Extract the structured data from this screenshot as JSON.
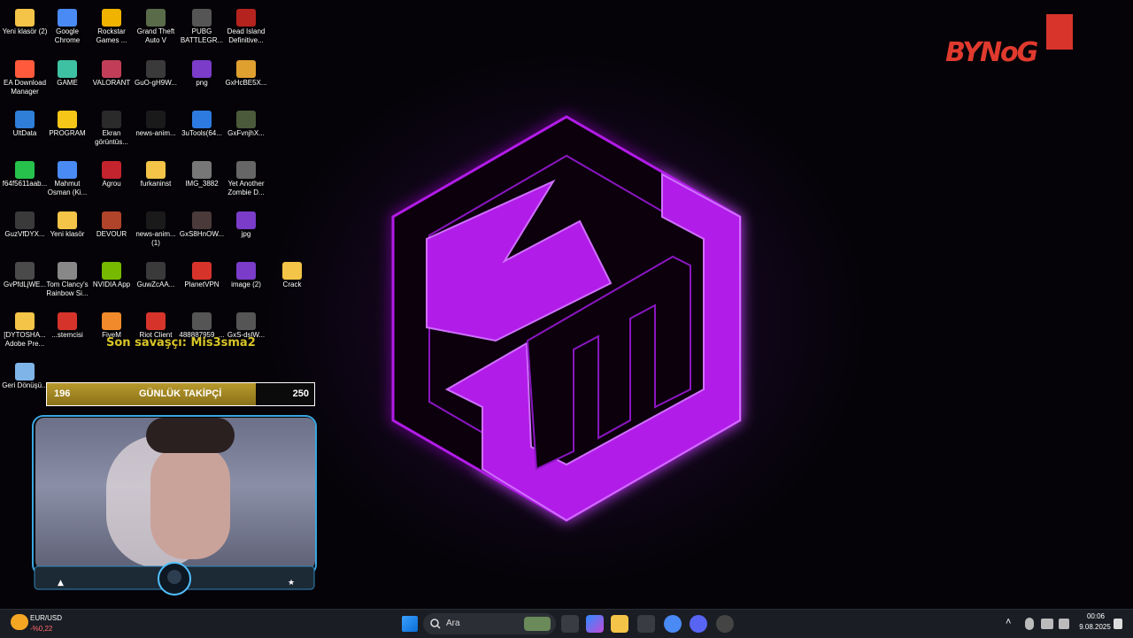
{
  "desktop": {
    "icons": [
      {
        "label": "Yeni klasör (2)",
        "color": "#f3c447"
      },
      {
        "label": "Google Chrome",
        "color": "#4a8af4"
      },
      {
        "label": "Rockstar Games ...",
        "color": "#f0b400"
      },
      {
        "label": "Grand Theft Auto V",
        "color": "#5a6b4a"
      },
      {
        "label": "PUBG BATTLEGR...",
        "color": "#555"
      },
      {
        "label": "Dead Island Definitive...",
        "color": "#b5231e"
      },
      {
        "label": "EA Download Manager",
        "color": "#ff5a3c"
      },
      {
        "label": "GAME",
        "color": "#3ec1a2"
      },
      {
        "label": "VALORANT",
        "color": "#c23e58"
      },
      {
        "label": "GuO-gH9W...",
        "color": "#3a3a3a"
      },
      {
        "label": "png",
        "color": "#7a3cc9"
      },
      {
        "label": "GxHcBE5X...",
        "color": "#e0a030"
      },
      {
        "label": "UltData",
        "color": "#2f7ed8"
      },
      {
        "label": "PROGRAM",
        "color": "#f5c518"
      },
      {
        "label": "Ekran görüntüs...",
        "color": "#2a2a2a"
      },
      {
        "label": "news-anim...",
        "color": "#1a1a1a"
      },
      {
        "label": "3uTools(64...",
        "color": "#2d7be0"
      },
      {
        "label": "GxFvnjhX...",
        "color": "#4a5a3a"
      },
      {
        "label": "f64f5611aab...",
        "color": "#27c24c"
      },
      {
        "label": "Mahmut Osman (Ki...",
        "color": "#4a8af4"
      },
      {
        "label": "Agrou",
        "color": "#c4242d"
      },
      {
        "label": "furkaninst",
        "color": "#f3c447"
      },
      {
        "label": "IMG_3882",
        "color": "#777"
      },
      {
        "label": "Yet Another Zombie D...",
        "color": "#666"
      },
      {
        "label": "GuzVfDYX...",
        "color": "#3a3a3a"
      },
      {
        "label": "Yeni klasör",
        "color": "#f3c447"
      },
      {
        "label": "DEVOUR",
        "color": "#b0442a"
      },
      {
        "label": "news-anim... (1)",
        "color": "#1a1a1a"
      },
      {
        "label": "GxS8HnOW...",
        "color": "#4a3a3a"
      },
      {
        "label": "jpg",
        "color": "#7a3cc9"
      },
      {
        "label": "GvPfdLjWE...",
        "color": "#4a4a4a"
      },
      {
        "label": "Tom Clancy's Rainbow Si...",
        "color": "#888"
      },
      {
        "label": "NVIDIA App",
        "color": "#76b900"
      },
      {
        "label": "GuwZcAA...",
        "color": "#3a3a3a"
      },
      {
        "label": "PlanetVPN",
        "color": "#d6342b"
      },
      {
        "label": "image (2)",
        "color": "#7a3cc9"
      },
      {
        "label": "Crack",
        "color": "#f3c447"
      },
      {
        "label": "[DYTOSHA... Adobe Pre...",
        "color": "#f3c447"
      },
      {
        "label": "...stemcisi",
        "color": "#d6342b"
      },
      {
        "label": "FiveM",
        "color": "#f08a2a"
      },
      {
        "label": "Riot Client",
        "color": "#d6342b"
      },
      {
        "label": "488887959_...",
        "color": "#555"
      },
      {
        "label": "GxS-dslW...",
        "color": "#555"
      },
      {
        "label": "Geri Dönüşü...",
        "color": "#7fb4e8"
      }
    ]
  },
  "wallpaper": {
    "accent": "#b21ce8",
    "glow": "#7a12a8"
  },
  "brand_logo": {
    "text": "BYNoG"
  },
  "overlay": {
    "last_fighter": "Son savaşçı: Mis3sma2",
    "follower_goal": {
      "label": "GÜNLÜK TAKİPÇİ",
      "current": "196",
      "target": "250",
      "progress": 0.78
    }
  },
  "taskbar": {
    "search_placeholder": "Ara",
    "widget": {
      "title": "EUR/USD",
      "change": "-%0,22"
    },
    "clock": {
      "time": "00:06",
      "date": "9.08.2025"
    }
  }
}
